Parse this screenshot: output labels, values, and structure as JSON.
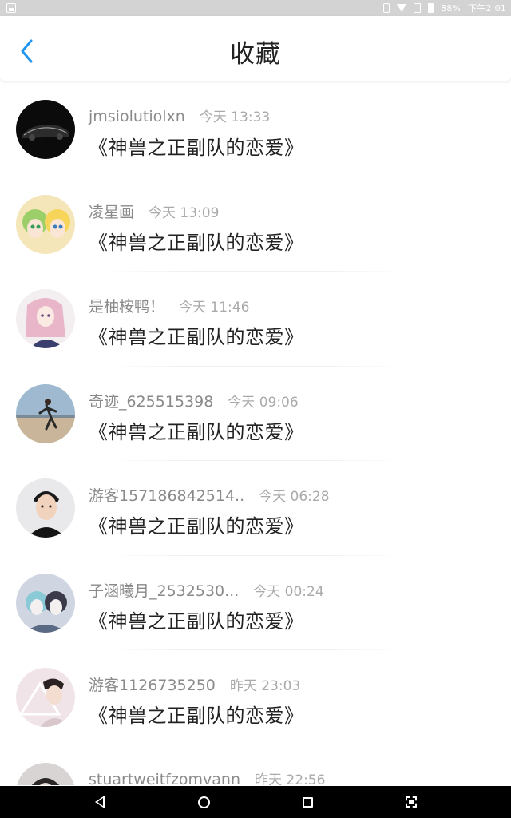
{
  "status_bar": {
    "battery": "88%",
    "time": "下午2:01"
  },
  "header": {
    "title": "收藏",
    "back_icon": "chevron-left-icon",
    "accent": "#2196f3"
  },
  "items": [
    {
      "username": "jmsiolutiolxn",
      "time": "今天 13:33",
      "work": "《神兽之正副队的恋爱》"
    },
    {
      "username": "凌星画",
      "time": "今天 13:09",
      "work": "《神兽之正副队的恋爱》"
    },
    {
      "username": "是柚桉鸭！",
      "time": "今天 11:46",
      "work": "《神兽之正副队的恋爱》"
    },
    {
      "username": "奇迹_625515398",
      "time": "今天 09:06",
      "work": "《神兽之正副队的恋爱》"
    },
    {
      "username": "游客157186842514..",
      "time": "今天 06:28",
      "work": "《神兽之正副队的恋爱》"
    },
    {
      "username": "子涵曦月_2532530...",
      "time": "今天 00:24",
      "work": "《神兽之正副队的恋爱》"
    },
    {
      "username": "游客1126735250",
      "time": "昨天 23:03",
      "work": "《神兽之正副队的恋爱》"
    },
    {
      "username": "stuartweitfzomvann",
      "time": "昨天 22:56",
      "work": ""
    }
  ],
  "nav_bar": {
    "icons": [
      "back-triangle-icon",
      "home-circle-icon",
      "recent-apps-square-icon",
      "screenshot-icon"
    ]
  }
}
